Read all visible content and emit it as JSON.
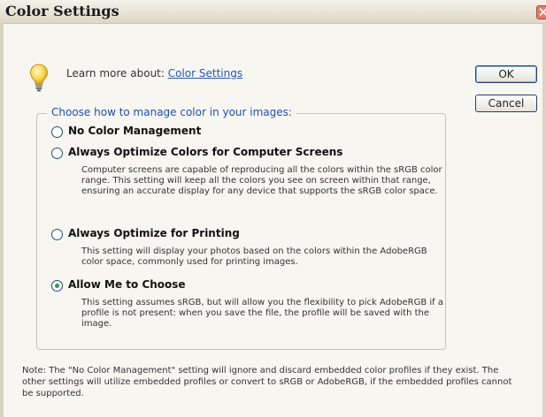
{
  "window": {
    "title": "Color Settings"
  },
  "learn": {
    "prefix": "Learn more about: ",
    "link": "Color Settings"
  },
  "buttons": {
    "ok": "OK",
    "cancel": "Cancel"
  },
  "group": {
    "legend": "Choose how to manage color in your images:"
  },
  "options": [
    {
      "label": "No Color Management",
      "description": "",
      "selected": false
    },
    {
      "label": "Always Optimize Colors for Computer Screens",
      "description": "Computer screens are capable of reproducing all the colors within the sRGB color range. This setting will keep all the colors you see on screen within that range, ensuring an accurate display for any device that supports the sRGB color space.",
      "selected": false
    },
    {
      "label": "Always Optimize for Printing",
      "description": "This setting will display your photos based on the colors within the AdobeRGB color space, commonly used for printing images.",
      "selected": false
    },
    {
      "label": "Allow Me to Choose",
      "description": "This setting assumes sRGB, but will allow you the flexibility to pick AdobeRGB if a profile is not present: when you save the file, the profile will be saved with the image.",
      "selected": true
    }
  ],
  "note": "Note: The \"No Color Management\" setting will ignore and discard embedded color profiles if they exist. The other settings will utilize embedded profiles or convert to sRGB or AdobeRGB, if the embedded profiles cannot be supported.",
  "colors": {
    "accent": "#1f4fb0",
    "link": "#2258b8",
    "radio_selected": "#2f9e3a"
  },
  "icons": {
    "info": "lightbulb-icon",
    "close": "close-icon"
  }
}
